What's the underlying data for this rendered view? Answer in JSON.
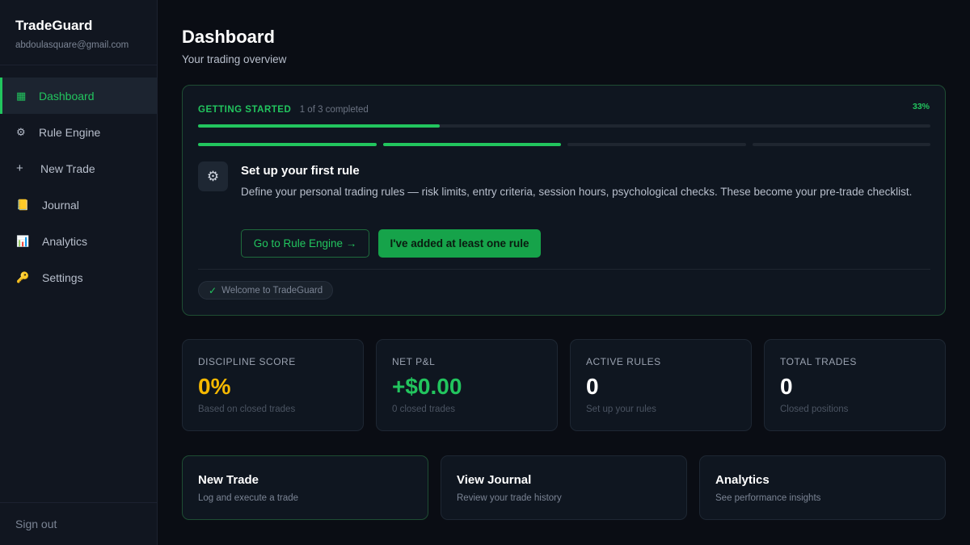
{
  "app": {
    "name": "TradeGuard",
    "user_email": "abdoulasquare@gmail.com"
  },
  "colors": {
    "accent": "#22c55e",
    "discipline_score": "#f5b800",
    "net_pnl": "#22c55e"
  },
  "sidebar": {
    "items": [
      {
        "label": "Dashboard",
        "icon": "grid-icon",
        "glyph": "▦",
        "active": true
      },
      {
        "label": "Rule Engine",
        "icon": "gear-icon",
        "glyph": "⚙",
        "active": false
      },
      {
        "label": "New Trade",
        "icon": "plus-icon",
        "glyph": "+",
        "active": false
      },
      {
        "label": "Journal",
        "icon": "notebook-icon",
        "glyph": "📒",
        "active": false
      },
      {
        "label": "Analytics",
        "icon": "chart-icon",
        "glyph": "📊",
        "active": false
      },
      {
        "label": "Settings",
        "icon": "key-icon",
        "glyph": "🔑",
        "active": false
      }
    ],
    "sign_out": "Sign out"
  },
  "header": {
    "title": "Dashboard",
    "subtitle": "Your trading overview"
  },
  "onboarding": {
    "label": "GETTING STARTED",
    "count": "1 of 3 completed",
    "percent_label": "33%",
    "progress": 0.33,
    "steps_done": [
      true,
      true,
      false,
      false
    ],
    "icon": "gear-icon",
    "icon_glyph": "⚙",
    "title": "Set up your first rule",
    "description": "Define your personal trading rules — risk limits, entry criteria, session hours, psychological checks. These become your pre-trade checklist.",
    "primary_link": "Go to Rule Engine →",
    "confirm_button": "I've added at least one rule",
    "completed_chip": {
      "check": "✓",
      "label": "Welcome to TradeGuard"
    }
  },
  "stats": [
    {
      "label": "DISCIPLINE SCORE",
      "value": "0%",
      "sub": "Based on closed trades",
      "color": "#f5b800"
    },
    {
      "label": "NET P&L",
      "value": "+$0.00",
      "sub": "0 closed trades",
      "color": "#22c55e"
    },
    {
      "label": "ACTIVE RULES",
      "value": "0",
      "sub": "Set up your rules",
      "color": "#ffffff"
    },
    {
      "label": "TOTAL TRADES",
      "value": "0",
      "sub": "Closed positions",
      "color": "#ffffff"
    }
  ],
  "actions": [
    {
      "title": "New Trade",
      "sub": "Log and execute a trade"
    },
    {
      "title": "View Journal",
      "sub": "Review your trade history"
    },
    {
      "title": "Analytics",
      "sub": "See performance insights"
    }
  ]
}
